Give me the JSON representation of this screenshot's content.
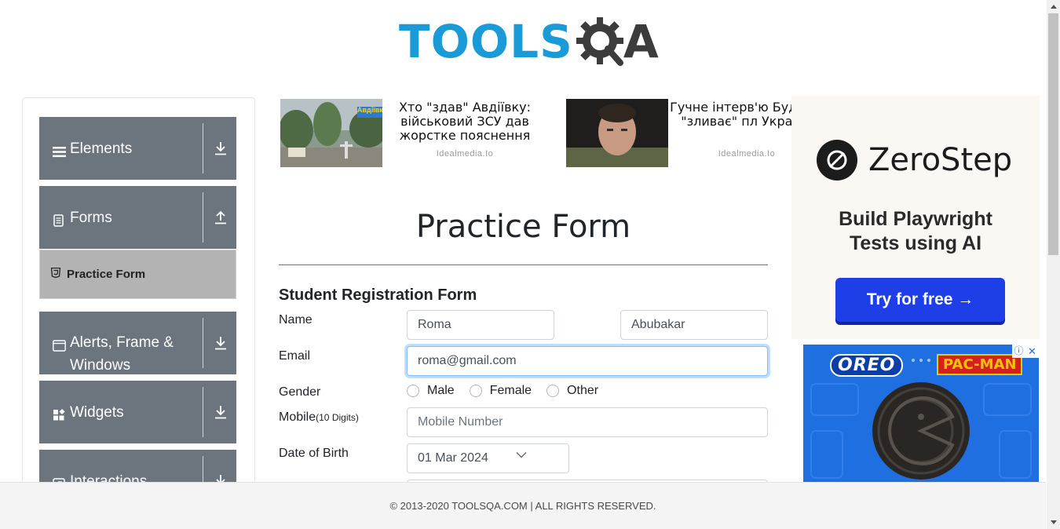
{
  "header": {
    "logo_text": "TOOLS",
    "logo_suffix": "A"
  },
  "sidebar": {
    "groups": [
      {
        "label": "Elements",
        "icon": "menu-icon",
        "arrow": "download-icon"
      },
      {
        "label": "Forms",
        "icon": "document-icon",
        "arrow": "upload-icon"
      },
      {
        "label": "Alerts, Frame &",
        "label2": "Windows",
        "icon": "window-icon",
        "arrow": "download-icon"
      },
      {
        "label": "Widgets",
        "icon": "widgets-icon",
        "arrow": "download-icon"
      },
      {
        "label": "Interactions",
        "icon": "interactions-icon",
        "arrow": "download-icon"
      }
    ],
    "active_item": {
      "label": "Practice Form",
      "icon": "html5-icon"
    }
  },
  "ads_top": [
    {
      "headline": "Хто \"здав\" Авдіївку: військовий ЗСУ дав жорстке пояснення",
      "source": "Idealmedia.Io",
      "thumb_sign": "Авдіївка"
    },
    {
      "headline": "Гучне інтерв'ю Буд хто \"зливає\" пл України",
      "source": "Idealmedia.Io"
    }
  ],
  "form": {
    "title": "Practice Form",
    "heading": "Student Registration Form",
    "name_label": "Name",
    "first_name": "Roma",
    "last_name": "Abubakar",
    "email_label": "Email",
    "email_value": "roma@gmail.com",
    "gender_label": "Gender",
    "gender_options": [
      "Male",
      "Female",
      "Other"
    ],
    "mobile_label": "Mobile",
    "mobile_hint": "(10 Digits)",
    "mobile_placeholder": "Mobile Number",
    "dob_label": "Date of Birth",
    "dob_value": "01 Mar 2024"
  },
  "ads_right": {
    "zerostep": {
      "brand": "ZeroStep",
      "tagline_1": "Build Playwright",
      "tagline_2": "Tests using AI",
      "cta": "Try for free →"
    },
    "oreo": {
      "brand": "OREO",
      "partner": "PAC-MAN",
      "adchoice": "ⓘ",
      "close": "✕"
    }
  },
  "footer": {
    "text": "© 2013-2020 TOOLSQA.COM | ALL RIGHTS RESERVED."
  },
  "colors": {
    "accent": "#1a9ad6",
    "sidebar": "#6c757d",
    "active": "#b3b3b3",
    "focus": "#80bdff",
    "cta": "#1e3fe8"
  }
}
